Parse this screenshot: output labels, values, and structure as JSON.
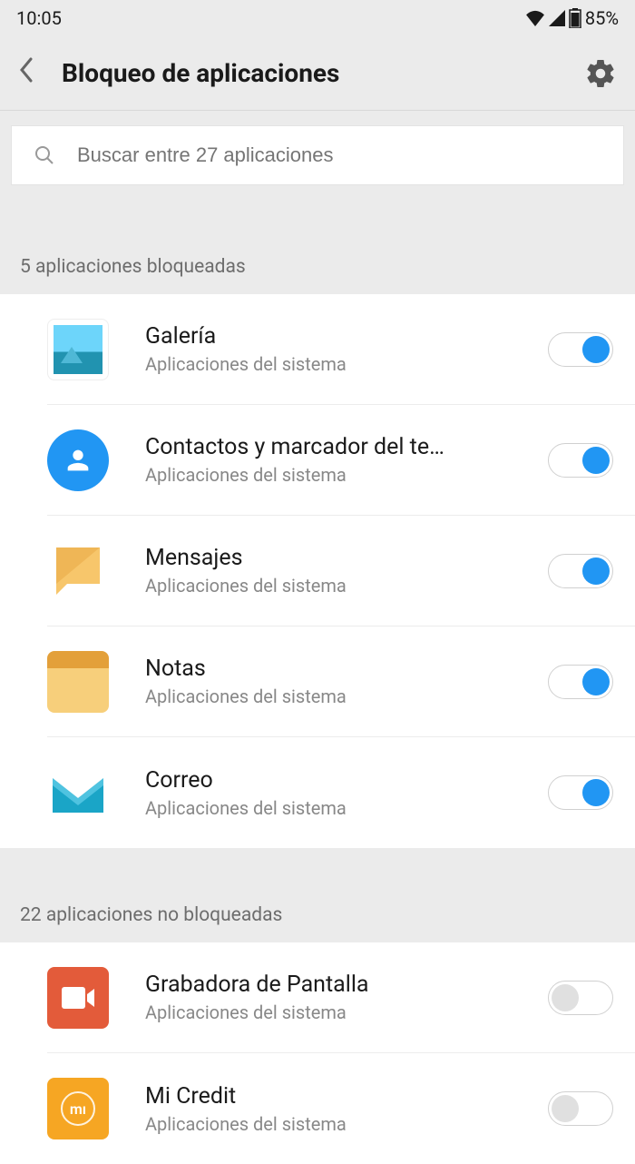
{
  "status": {
    "time": "10:05",
    "battery": "85%"
  },
  "header": {
    "title": "Bloqueo de aplicaciones"
  },
  "search": {
    "placeholder": "Buscar entre 27 aplicaciones"
  },
  "sections": {
    "locked_header": "5 aplicaciones bloqueadas",
    "unlocked_header": "22 aplicaciones no bloqueadas"
  },
  "apps": {
    "locked": [
      {
        "name": "Galería",
        "sub": "Aplicaciones del sistema",
        "on": true
      },
      {
        "name": "Contactos y marcador del te…",
        "sub": "Aplicaciones del sistema",
        "on": true
      },
      {
        "name": "Mensajes",
        "sub": "Aplicaciones del sistema",
        "on": true
      },
      {
        "name": "Notas",
        "sub": "Aplicaciones del sistema",
        "on": true
      },
      {
        "name": "Correo",
        "sub": "Aplicaciones del sistema",
        "on": true
      }
    ],
    "unlocked": [
      {
        "name": "Grabadora de Pantalla",
        "sub": "Aplicaciones del sistema",
        "on": false
      },
      {
        "name": "Mi Credit",
        "sub": "Aplicaciones del sistema",
        "on": false
      }
    ]
  }
}
